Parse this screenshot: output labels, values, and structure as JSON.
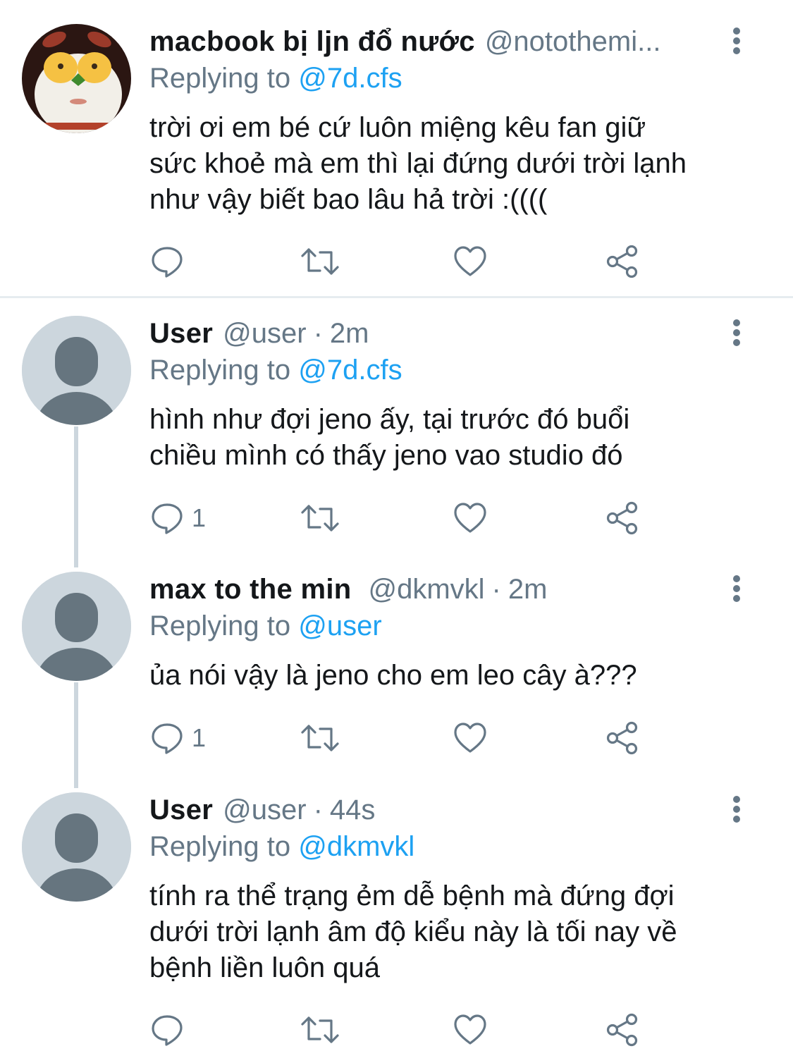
{
  "tweets": [
    {
      "name": "macbook bị ljn đổ nước",
      "handle": "@nototheminimum",
      "handle_display": "@notothemi...",
      "time": "",
      "replying_label": "Replying to",
      "replying_to": "@7d.cfs",
      "lines": [
        "trời ơi em bé cứ luôn miệng kêu fan giữ",
        "sức khoẻ mà em thì lại đứng dưới trời lạnh",
        "như vậy biết bao lâu hả trời :(((("
      ],
      "reply_count": "",
      "avatar": "custom-photo"
    },
    {
      "name": "User",
      "handle": "@user",
      "time": "2m",
      "replying_label": "Replying to",
      "replying_to": "@7d.cfs",
      "lines": [
        "hình như đợi jeno ấy, tại trước đó buổi",
        "chiều mình có thấy jeno vao studio đó"
      ],
      "reply_count": "1",
      "avatar": "default-avatar"
    },
    {
      "name": "max to the min",
      "handle": "@dkmvkl",
      "time": "2m",
      "replying_label": "Replying to",
      "replying_to": "@user",
      "lines": [
        "ủa nói vậy là jeno cho em leo cây à???"
      ],
      "reply_count": "1",
      "avatar": "default-avatar"
    },
    {
      "name": "User",
      "handle": "@user",
      "time": "44s",
      "replying_label": "Replying to",
      "replying_to": "@dkmvkl",
      "lines": [
        "tính ra thể trạng ẻm dễ bệnh mà đứng đợi",
        "dưới trời lạnh âm độ kiểu này là tối nay về",
        "bệnh liền luôn quá"
      ],
      "reply_count": "",
      "avatar": "default-avatar"
    }
  ],
  "separator": "·",
  "icons": {
    "reply": "reply-icon",
    "retweet": "retweet-icon",
    "like": "like-icon",
    "share": "share-icon",
    "more": "more-vertical-icon"
  },
  "colors": {
    "link": "#1da1f2",
    "secondary_text": "#657786",
    "primary_text": "#14171a",
    "thread_line": "#ccd6dd",
    "divider": "#e6ecf0"
  }
}
